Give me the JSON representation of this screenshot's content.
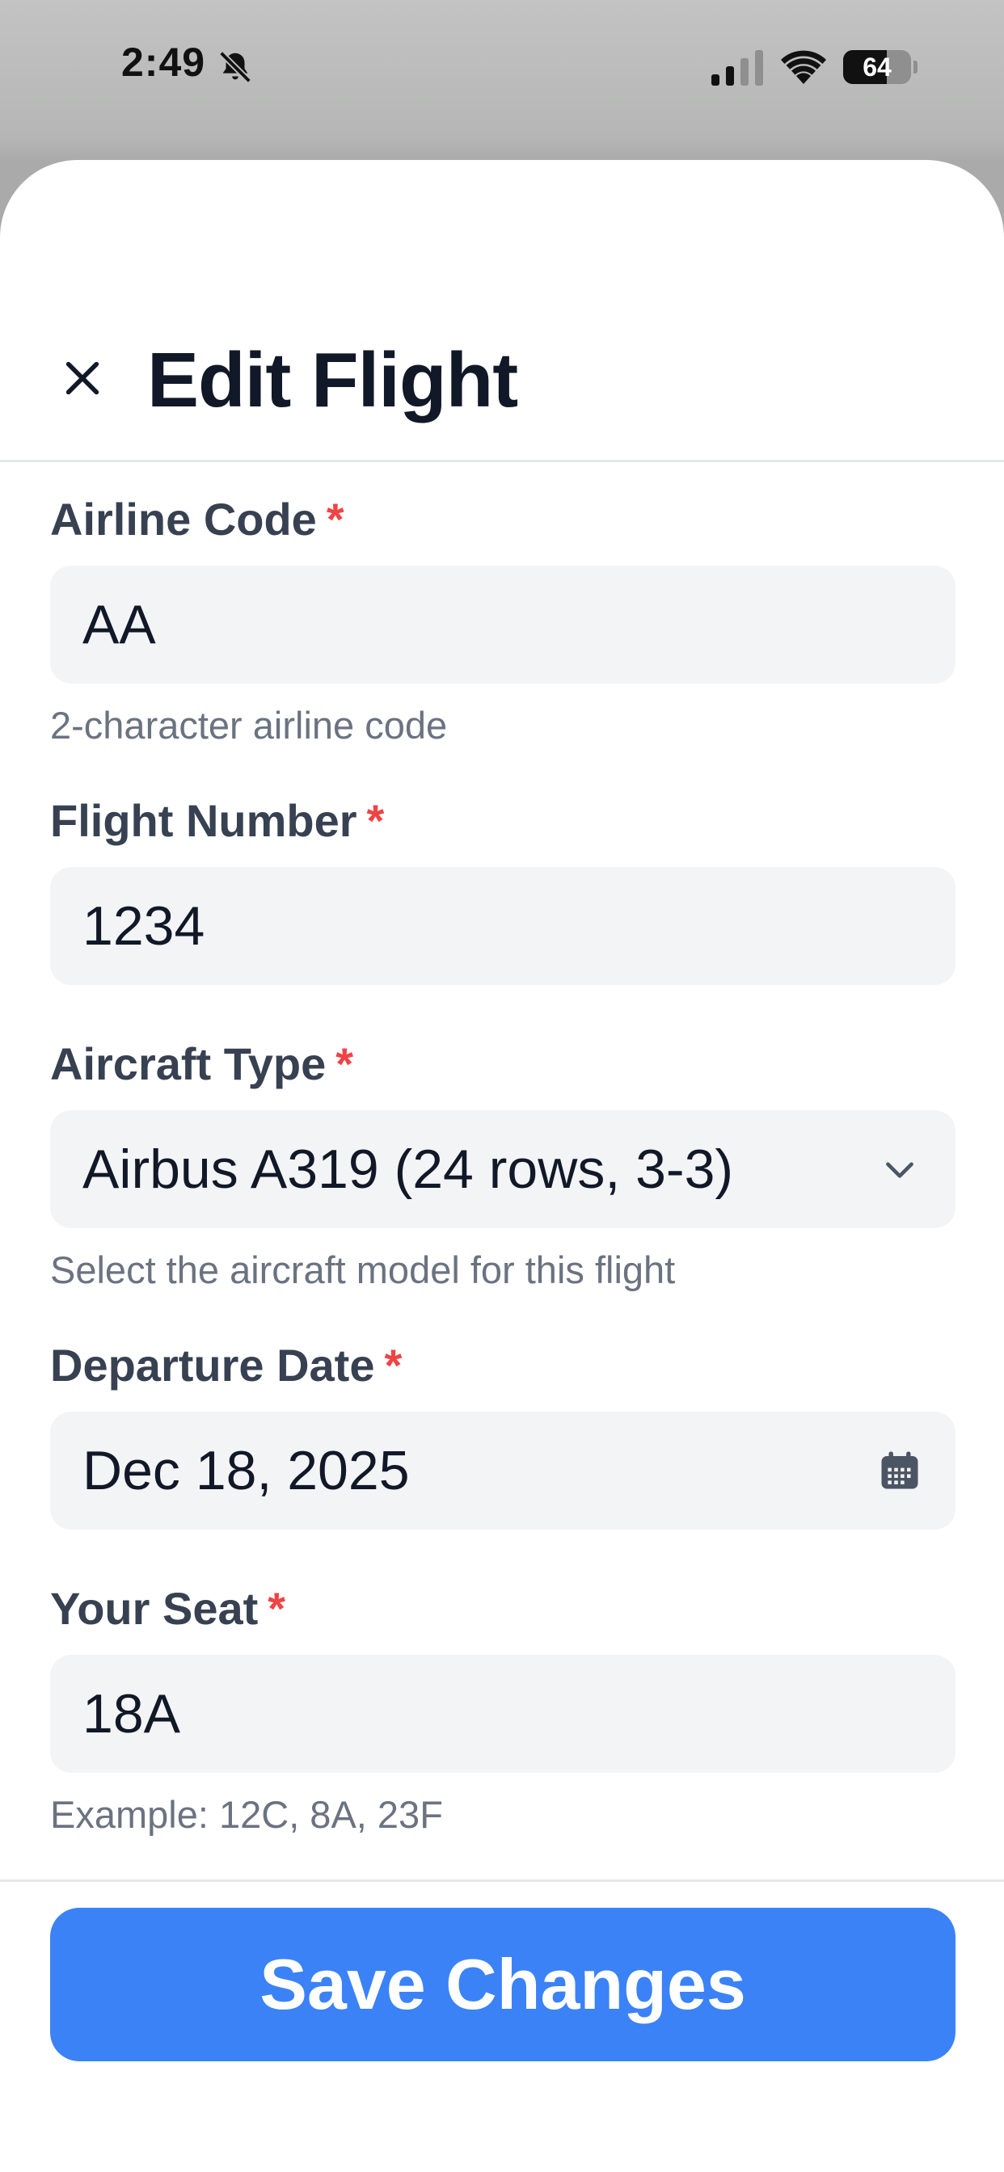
{
  "status_bar": {
    "time": "2:49",
    "battery_level": "64",
    "battery_fraction": 0.64,
    "icons": [
      "bell-slash-icon",
      "cellular-signal-icon",
      "wifi-icon",
      "battery-icon"
    ]
  },
  "header": {
    "title": "Edit Flight",
    "close_icon": "close-icon"
  },
  "form": {
    "required_marker": "*",
    "airline_code": {
      "label": "Airline Code",
      "value": "AA",
      "helper": "2-character airline code"
    },
    "flight_number": {
      "label": "Flight Number",
      "value": "1234"
    },
    "aircraft_type": {
      "label": "Aircraft Type",
      "selected": "Airbus A319 (24 rows, 3-3)",
      "helper": "Select the aircraft model for this flight",
      "icon": "chevron-down-icon"
    },
    "departure_date": {
      "label": "Departure Date",
      "value": "Dec 18, 2025",
      "icon": "calendar-icon"
    },
    "your_seat": {
      "label": "Your Seat",
      "value": "18A",
      "helper": "Example: 12C, 8A, 23F"
    }
  },
  "footer": {
    "save_label": "Save Changes"
  },
  "colors": {
    "accent": "#3b82f6",
    "required": "#ef4444",
    "input_bg": "#f3f4f6",
    "label": "#374151",
    "helper": "#6b7280",
    "title": "#111827"
  }
}
